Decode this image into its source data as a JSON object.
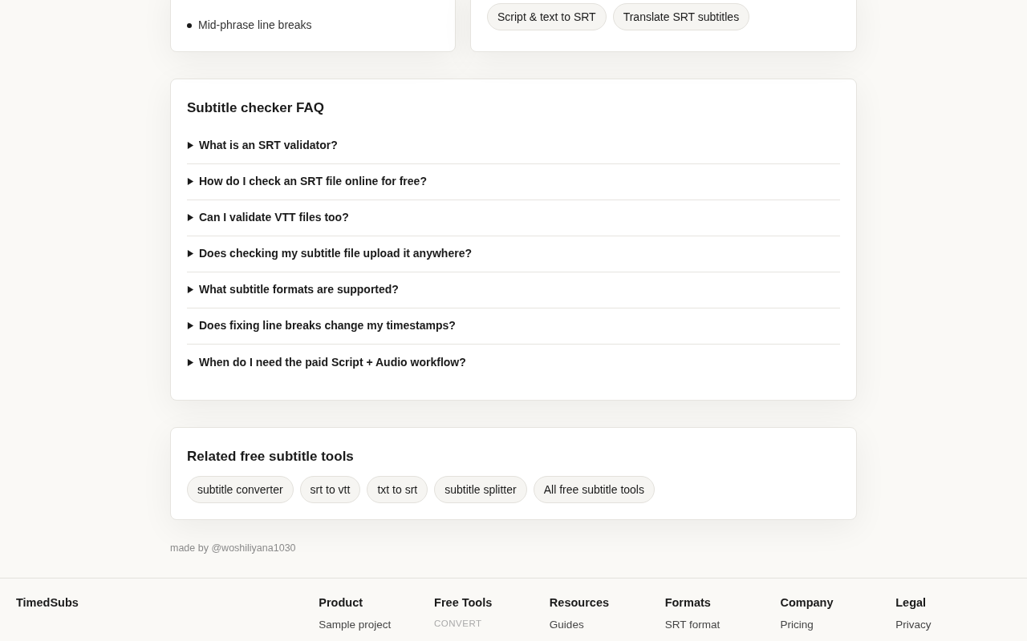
{
  "top_left_card": {
    "bullets": [
      "Mid-phrase line breaks"
    ]
  },
  "top_right_card": {
    "chips": [
      "Script & text to SRT",
      "Translate SRT subtitles"
    ]
  },
  "faq": {
    "title": "Subtitle checker FAQ",
    "items": [
      {
        "question": "What is an SRT validator?",
        "expanded": false
      },
      {
        "question": "How do I check an SRT file online for free?",
        "expanded": false
      },
      {
        "question": "Can I validate VTT files too?",
        "expanded": false
      },
      {
        "question": "Does checking my subtitle file upload it anywhere?",
        "expanded": false
      },
      {
        "question": "What subtitle formats are supported?",
        "expanded": false
      },
      {
        "question": "Does fixing line breaks change my timestamps?",
        "expanded": false
      },
      {
        "question": "When do I need the paid Script + Audio workflow?",
        "expanded": false
      }
    ]
  },
  "related": {
    "title": "Related free subtitle tools",
    "chips": [
      "subtitle converter",
      "srt to vtt",
      "txt to srt",
      "subtitle splitter",
      "All free subtitle tools"
    ]
  },
  "credit": "made by @woshiliyana1030",
  "footer": {
    "brand": "TimedSubs",
    "columns": [
      {
        "heading": "Product",
        "links": [
          {
            "text": "Sample project",
            "kind": "link"
          }
        ]
      },
      {
        "heading": "Free Tools",
        "links": [
          {
            "text": "CONVERT",
            "kind": "label"
          }
        ]
      },
      {
        "heading": "Resources",
        "links": [
          {
            "text": "Guides",
            "kind": "link"
          }
        ]
      },
      {
        "heading": "Formats",
        "links": [
          {
            "text": "SRT format",
            "kind": "link"
          }
        ]
      },
      {
        "heading": "Company",
        "links": [
          {
            "text": "Pricing",
            "kind": "link"
          }
        ]
      },
      {
        "heading": "Legal",
        "links": [
          {
            "text": "Privacy",
            "kind": "link"
          }
        ]
      }
    ]
  }
}
